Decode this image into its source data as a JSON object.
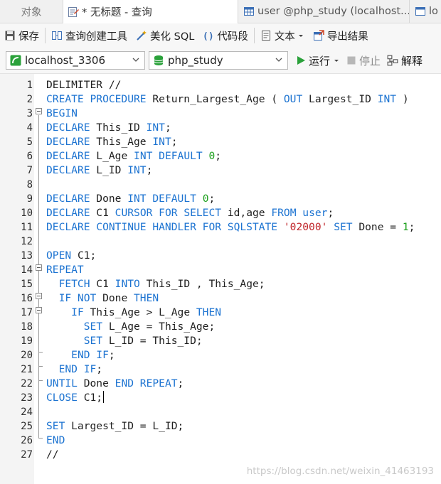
{
  "tabs": {
    "objects": "对象",
    "active": "* 无标题 - 查询",
    "user": "user @php_study (localhost...",
    "partial": "lo"
  },
  "toolbar": {
    "save": "保存",
    "query_builder": "查询创建工具",
    "beautify": "美化 SQL",
    "snippet": "代码段",
    "text": "文本",
    "export": "导出结果"
  },
  "connection": {
    "server": "localhost_3306",
    "database": "php_study",
    "run": "运行",
    "stop": "停止",
    "explain": "解释"
  },
  "editor": {
    "lines": [
      [
        {
          "t": "DELIMITER //",
          "c": ""
        }
      ],
      [
        {
          "t": "CREATE PROCEDURE",
          "c": "kw"
        },
        {
          "t": " Return_Largest_Age ( ",
          "c": ""
        },
        {
          "t": "OUT",
          "c": "kw"
        },
        {
          "t": " Largest_ID ",
          "c": ""
        },
        {
          "t": "INT",
          "c": "kw"
        },
        {
          "t": " )",
          "c": ""
        }
      ],
      [
        {
          "t": "BEGIN",
          "c": "kw"
        }
      ],
      [
        {
          "t": "DECLARE",
          "c": "kw"
        },
        {
          "t": " This_ID ",
          "c": ""
        },
        {
          "t": "INT",
          "c": "kw"
        },
        {
          "t": ";",
          "c": ""
        }
      ],
      [
        {
          "t": "DECLARE",
          "c": "kw"
        },
        {
          "t": " This_Age ",
          "c": ""
        },
        {
          "t": "INT",
          "c": "kw"
        },
        {
          "t": ";",
          "c": ""
        }
      ],
      [
        {
          "t": "DECLARE",
          "c": "kw"
        },
        {
          "t": " L_Age ",
          "c": ""
        },
        {
          "t": "INT DEFAULT",
          "c": "kw"
        },
        {
          "t": " ",
          "c": ""
        },
        {
          "t": "0",
          "c": "num"
        },
        {
          "t": ";",
          "c": ""
        }
      ],
      [
        {
          "t": "DECLARE",
          "c": "kw"
        },
        {
          "t": " L_ID ",
          "c": ""
        },
        {
          "t": "INT",
          "c": "kw"
        },
        {
          "t": ";",
          "c": ""
        }
      ],
      [],
      [
        {
          "t": "DECLARE",
          "c": "kw"
        },
        {
          "t": " Done ",
          "c": ""
        },
        {
          "t": "INT DEFAULT",
          "c": "kw"
        },
        {
          "t": " ",
          "c": ""
        },
        {
          "t": "0",
          "c": "num"
        },
        {
          "t": ";",
          "c": ""
        }
      ],
      [
        {
          "t": "DECLARE",
          "c": "kw"
        },
        {
          "t": " C1 ",
          "c": ""
        },
        {
          "t": "CURSOR FOR SELECT",
          "c": "kw"
        },
        {
          "t": " id,age ",
          "c": ""
        },
        {
          "t": "FROM",
          "c": "kw"
        },
        {
          "t": " ",
          "c": ""
        },
        {
          "t": "user",
          "c": "kw"
        },
        {
          "t": ";",
          "c": ""
        }
      ],
      [
        {
          "t": "DECLARE CONTINUE HANDLER FOR SQLSTATE",
          "c": "kw"
        },
        {
          "t": " ",
          "c": ""
        },
        {
          "t": "'02000'",
          "c": "str"
        },
        {
          "t": " ",
          "c": ""
        },
        {
          "t": "SET",
          "c": "kw"
        },
        {
          "t": " Done = ",
          "c": ""
        },
        {
          "t": "1",
          "c": "num"
        },
        {
          "t": ";",
          "c": ""
        }
      ],
      [],
      [
        {
          "t": "OPEN",
          "c": "kw"
        },
        {
          "t": " C1;",
          "c": ""
        }
      ],
      [
        {
          "t": "REPEAT",
          "c": "kw"
        }
      ],
      [
        {
          "t": "  ",
          "c": ""
        },
        {
          "t": "FETCH",
          "c": "kw"
        },
        {
          "t": " C1 ",
          "c": ""
        },
        {
          "t": "INTO",
          "c": "kw"
        },
        {
          "t": " This_ID , This_Age;",
          "c": ""
        }
      ],
      [
        {
          "t": "  ",
          "c": ""
        },
        {
          "t": "IF NOT",
          "c": "kw"
        },
        {
          "t": " Done ",
          "c": ""
        },
        {
          "t": "THEN",
          "c": "kw"
        }
      ],
      [
        {
          "t": "    ",
          "c": ""
        },
        {
          "t": "IF",
          "c": "kw"
        },
        {
          "t": " This_Age > L_Age ",
          "c": ""
        },
        {
          "t": "THEN",
          "c": "kw"
        }
      ],
      [
        {
          "t": "      ",
          "c": ""
        },
        {
          "t": "SET",
          "c": "kw"
        },
        {
          "t": " L_Age = This_Age;",
          "c": ""
        }
      ],
      [
        {
          "t": "      ",
          "c": ""
        },
        {
          "t": "SET",
          "c": "kw"
        },
        {
          "t": " L_ID = This_ID;",
          "c": ""
        }
      ],
      [
        {
          "t": "    ",
          "c": ""
        },
        {
          "t": "END IF",
          "c": "kw"
        },
        {
          "t": ";",
          "c": ""
        }
      ],
      [
        {
          "t": "  ",
          "c": ""
        },
        {
          "t": "END IF",
          "c": "kw"
        },
        {
          "t": ";",
          "c": ""
        }
      ],
      [
        {
          "t": "UNTIL",
          "c": "kw"
        },
        {
          "t": " Done ",
          "c": ""
        },
        {
          "t": "END REPEAT",
          "c": "kw"
        },
        {
          "t": ";",
          "c": ""
        }
      ],
      [
        {
          "t": "CLOSE",
          "c": "kw"
        },
        {
          "t": " C1;",
          "c": ""
        }
      ],
      [],
      [
        {
          "t": "SET",
          "c": "kw"
        },
        {
          "t": " Largest_ID = L_ID;",
          "c": ""
        }
      ],
      [
        {
          "t": "END",
          "c": "kw"
        }
      ],
      [
        {
          "t": "//",
          "c": ""
        }
      ]
    ]
  },
  "watermark": "https://blog.csdn.net/weixin_41463193",
  "colors": {
    "keyword": "#1c73d1",
    "number": "#1a9f1a",
    "string": "#c0262b",
    "run_green": "#2aa13a"
  }
}
